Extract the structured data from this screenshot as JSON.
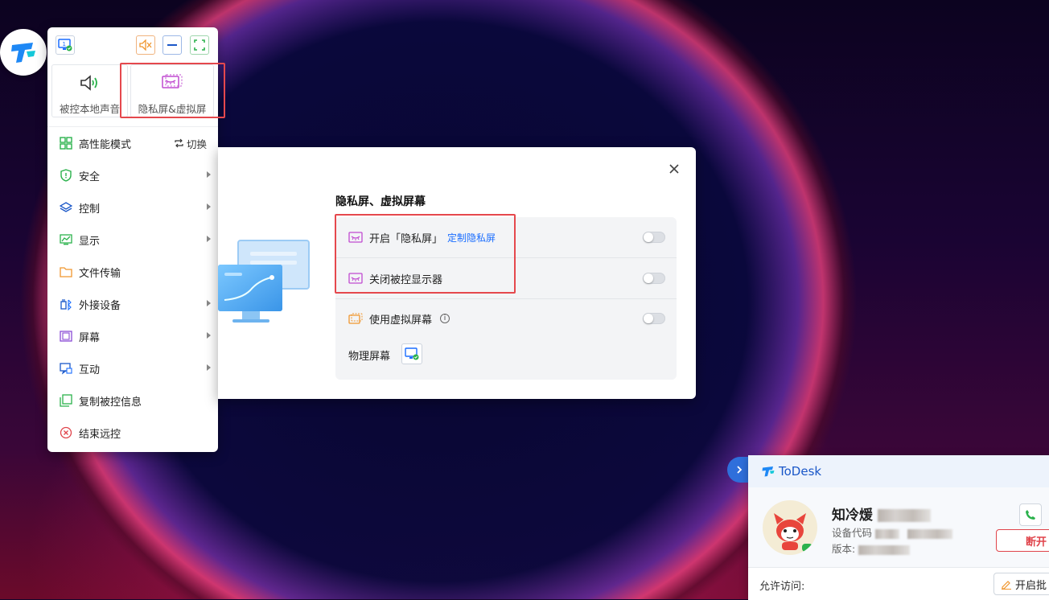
{
  "toolbar": {
    "tiles": [
      {
        "label": "被控本地声音",
        "icon": "speaker-icon"
      },
      {
        "label": "隐私屏&虚拟屏",
        "icon": "privacy-screen-icon"
      }
    ],
    "menu": [
      {
        "label": "高性能模式",
        "icon": "grid-icon",
        "action": "切换"
      },
      {
        "label": "安全",
        "icon": "shield-icon"
      },
      {
        "label": "控制",
        "icon": "layers-icon"
      },
      {
        "label": "显示",
        "icon": "display-chart-icon"
      },
      {
        "label": "文件传输",
        "icon": "folder-icon"
      },
      {
        "label": "外接设备",
        "icon": "usb-device-icon"
      },
      {
        "label": "屏幕",
        "icon": "screen-icon"
      },
      {
        "label": "互动",
        "icon": "chat-icon"
      },
      {
        "label": "复制被控信息",
        "icon": "copy-icon"
      },
      {
        "label": "结束远控",
        "icon": "close-circle-icon"
      }
    ]
  },
  "dialog": {
    "title": "隐私屏、虚拟屏幕",
    "rows": [
      {
        "label": "开启「隐私屏」",
        "link": "定制隐私屏",
        "enabled": false
      },
      {
        "label": "关闭被控显示器",
        "enabled": false
      },
      {
        "label": "使用虚拟屏幕",
        "enabled": false
      }
    ],
    "physical_label": "物理屏幕",
    "info_glyph": "i"
  },
  "todesk": {
    "brand": "ToDesk",
    "name": "知冷煖",
    "device_code_label": "设备代码",
    "version_label": "版本:",
    "disconnect_label": "断开",
    "allow_label": "允许访问:",
    "enable_label": "开启批"
  },
  "colors": {
    "accent_blue": "#1a6dff",
    "highlight_red": "#e5484d",
    "privacy_magenta": "#c04ad0",
    "virtual_orange": "#f0962e",
    "green": "#2bb24c"
  }
}
